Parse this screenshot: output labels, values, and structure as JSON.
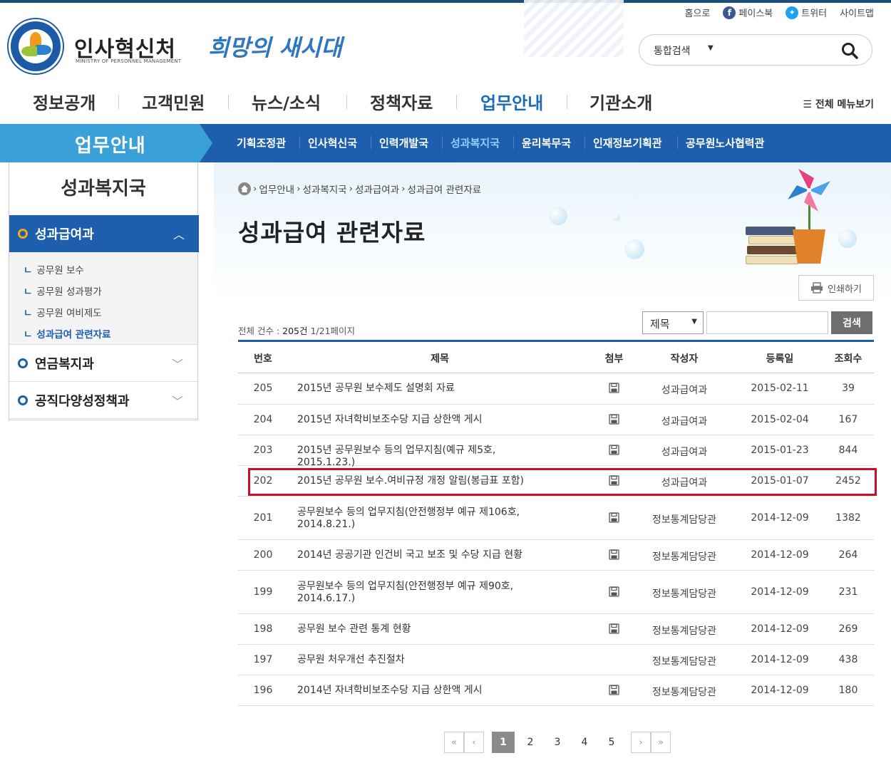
{
  "header": {
    "org_name": "인사혁신처",
    "org_name_en": "MINISTRY OF PERSONNEL MANAGEMENT",
    "slogan": "희망의 새시대",
    "utils": {
      "home": "홈으로",
      "facebook": "페이스북",
      "twitter": "트위터",
      "sitemap": "사이트맵"
    },
    "search": {
      "scope": "통합검색",
      "value": ""
    }
  },
  "gnb": {
    "items": [
      "정보공개",
      "고객민원",
      "뉴스/소식",
      "정책자료",
      "업무안내",
      "기관소개"
    ],
    "active": "업무안내",
    "all_menu": "전체 메뉴보기"
  },
  "subnav": {
    "title": "업무안내",
    "items": [
      "기획조정관",
      "인사혁신국",
      "인력개발국",
      "성과복지국",
      "윤리복무국",
      "인재정보기획관",
      "공무원노사협력관"
    ],
    "active": "성과복지국"
  },
  "sidebar": {
    "title": "성과복지국",
    "active_menu": "성과급여과",
    "sub_items": [
      "공무원 보수",
      "공무원 성과평가",
      "공무원 여비제도",
      "성과급여 관련자료"
    ],
    "active_sub": "성과급여 관련자료",
    "menus": [
      "연금복지과",
      "공직다양성정책과"
    ]
  },
  "breadcrumb": [
    "업무안내",
    "성과복지국",
    "성과급여과",
    "성과급여 관련자료"
  ],
  "page_title": "성과급여 관련자료",
  "print_label": "인쇄하기",
  "list_info": {
    "prefix": "전체 건수 : ",
    "count": "205건",
    "page": "1/21페이지"
  },
  "filter": {
    "field": "제목",
    "value": "",
    "button": "검색"
  },
  "table": {
    "headers": {
      "no": "번호",
      "title": "제목",
      "attach": "첨부",
      "author": "작성자",
      "date": "등록일",
      "views": "조회수"
    },
    "rows": [
      {
        "no": "205",
        "title": "2015년 공무원 보수제도 설명회 자료",
        "attach": true,
        "author": "성과급여과",
        "date": "2015-02-11",
        "views": "39"
      },
      {
        "no": "204",
        "title": "2015년 자녀학비보조수당 지급 상한액 게시",
        "attach": true,
        "author": "성과급여과",
        "date": "2015-02-04",
        "views": "167"
      },
      {
        "no": "203",
        "title": "2015년 공무원보수 등의 업무지침(예규 제5호, 2015.1.23.)",
        "attach": true,
        "author": "성과급여과",
        "date": "2015-01-23",
        "views": "844"
      },
      {
        "no": "202",
        "title": "2015년 공무원 보수.여비규정 개정 알림(봉급표 포함)",
        "attach": true,
        "author": "성과급여과",
        "date": "2015-01-07",
        "views": "2452",
        "highlight": true
      },
      {
        "no": "201",
        "title": "공무원보수 등의 업무지침(안전행정부 예규 제106호, 2014.8.21.)",
        "attach": true,
        "author": "정보통계담당관",
        "date": "2014-12-09",
        "views": "1382"
      },
      {
        "no": "200",
        "title": "2014년 공공기관 인건비 국고 보조 및 수당 지급 현황",
        "attach": true,
        "author": "정보통계담당관",
        "date": "2014-12-09",
        "views": "264"
      },
      {
        "no": "199",
        "title": "공무원보수 등의 업무지침(안전행정부 예규 제90호, 2014.6.17.)",
        "attach": true,
        "author": "정보통계담당관",
        "date": "2014-12-09",
        "views": "231"
      },
      {
        "no": "198",
        "title": "공무원 보수 관련 통계 현황",
        "attach": true,
        "author": "정보통계담당관",
        "date": "2014-12-09",
        "views": "269"
      },
      {
        "no": "197",
        "title": "공무원 처우개선 추진절차",
        "attach": false,
        "author": "정보통계담당관",
        "date": "2014-12-09",
        "views": "438"
      },
      {
        "no": "196",
        "title": "2014년 자녀학비보조수당 지급 상한액 게시",
        "attach": true,
        "author": "정보통계담당관",
        "date": "2014-12-09",
        "views": "180"
      }
    ]
  },
  "pagination": {
    "first": "«",
    "prev": "‹",
    "pages": [
      "1",
      "2",
      "3",
      "4",
      "5"
    ],
    "current": "1",
    "next": "›",
    "last": "»"
  },
  "colors": {
    "brand": "#1d5fad",
    "accent": "#3aa0d8",
    "highlight": "#c8102e"
  }
}
